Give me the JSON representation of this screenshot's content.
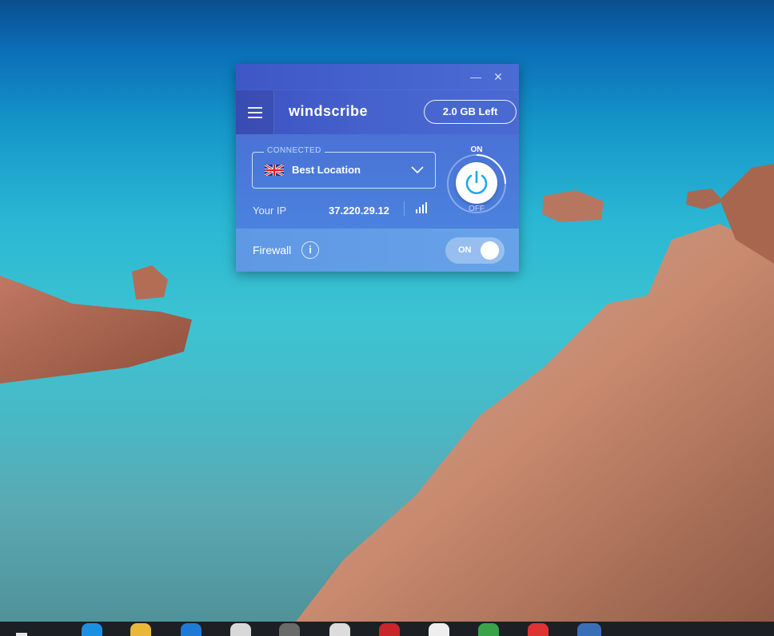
{
  "window": {
    "minimize_glyph": "—",
    "close_glyph": "✕"
  },
  "header": {
    "logo": "windscribe",
    "data_left": "2.0 GB Left",
    "menu_icon": "hamburger-icon"
  },
  "connection": {
    "status": "CONNECTED",
    "location": "Best Location",
    "flag_icon": "uk-flag-icon",
    "ip_label": "Your IP",
    "ip_value": "37.220.29.12",
    "power_on_label": "ON",
    "power_off_label": "OFF"
  },
  "firewall": {
    "label": "Firewall",
    "info_glyph": "i",
    "toggle_label": "ON"
  },
  "colors": {
    "accent": "#4a6ad3",
    "power_icon": "#1aa9e8",
    "firewall_bg": "#67a2e8"
  }
}
